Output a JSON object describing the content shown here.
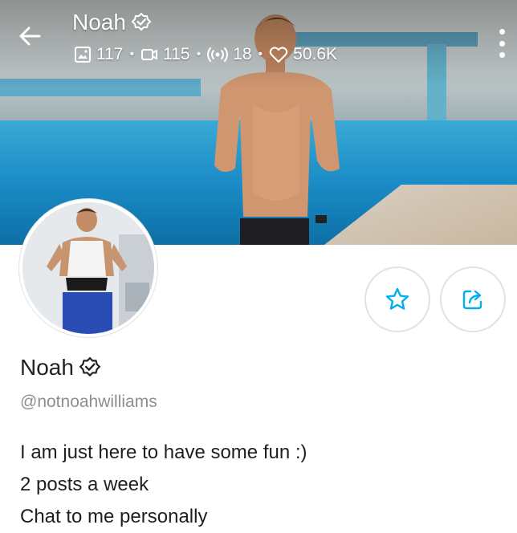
{
  "header": {
    "name": "Noah",
    "stats": {
      "photos": "117",
      "videos": "115",
      "streams": "18",
      "likes": "50.6K"
    }
  },
  "profile": {
    "name": "Noah",
    "handle": "@notnoahwilliams",
    "bio": [
      "I am just here to have some fun :)",
      "2 posts a week",
      "Chat to me personally"
    ]
  },
  "colors": {
    "accent": "#00aff0",
    "verified": "#ffffff"
  },
  "icons": [
    "back-arrow-icon",
    "verified-badge-icon",
    "photo-icon",
    "video-icon",
    "stream-icon",
    "heart-icon",
    "kebab-menu-icon",
    "star-icon",
    "share-icon"
  ]
}
